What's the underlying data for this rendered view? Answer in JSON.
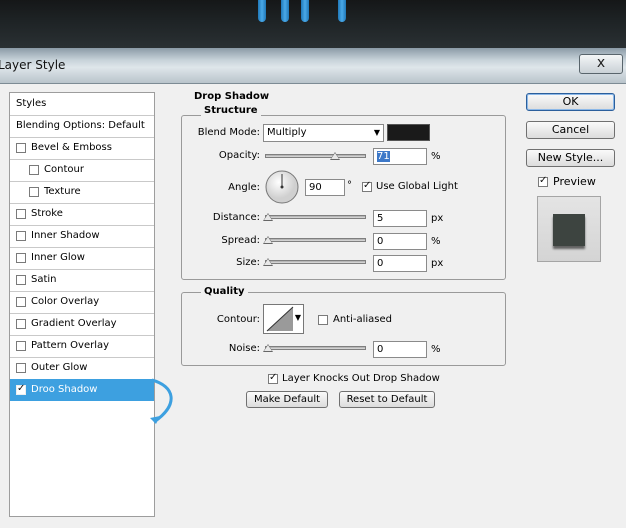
{
  "window": {
    "title": "Layer Style",
    "close_label": "x"
  },
  "sidebar": {
    "items": [
      {
        "label": "Styles",
        "checkbox": false,
        "checked": false,
        "selected": false,
        "indent": false
      },
      {
        "label": "Blending Options: Default",
        "checkbox": false,
        "checked": false,
        "selected": false,
        "indent": false
      },
      {
        "label": "Bevel & Emboss",
        "checkbox": true,
        "checked": false,
        "selected": false,
        "indent": false
      },
      {
        "label": "Contour",
        "checkbox": true,
        "checked": false,
        "selected": false,
        "indent": true
      },
      {
        "label": "Texture",
        "checkbox": true,
        "checked": false,
        "selected": false,
        "indent": true
      },
      {
        "label": "Stroke",
        "checkbox": true,
        "checked": false,
        "selected": false,
        "indent": false
      },
      {
        "label": "Inner Shadow",
        "checkbox": true,
        "checked": false,
        "selected": false,
        "indent": false
      },
      {
        "label": "Inner Glow",
        "checkbox": true,
        "checked": false,
        "selected": false,
        "indent": false
      },
      {
        "label": "Satin",
        "checkbox": true,
        "checked": false,
        "selected": false,
        "indent": false
      },
      {
        "label": "Color Overlay",
        "checkbox": true,
        "checked": false,
        "selected": false,
        "indent": false
      },
      {
        "label": "Gradient Overlay",
        "checkbox": true,
        "checked": false,
        "selected": false,
        "indent": false
      },
      {
        "label": "Pattern Overlay",
        "checkbox": true,
        "checked": false,
        "selected": false,
        "indent": false
      },
      {
        "label": "Outer Glow",
        "checkbox": true,
        "checked": false,
        "selected": false,
        "indent": false
      },
      {
        "label": "Droo Shadow",
        "checkbox": true,
        "checked": true,
        "selected": true,
        "indent": false
      }
    ]
  },
  "drop_shadow": {
    "title": "Drop Shadow",
    "structure": {
      "title": "Structure",
      "blend_mode_label": "Blend Mode:",
      "blend_mode_value": "Multiply",
      "shadow_color": "#1a1a1a",
      "opacity_label": "Opacity:",
      "opacity_value": "71",
      "opacity_unit": "%",
      "opacity_fraction": 0.71,
      "angle_label": "Angle:",
      "angle_value": "90",
      "angle_unit": "°",
      "use_global_light_label": "Use Global Light",
      "use_global_light_checked": true,
      "distance_label": "Distance:",
      "distance_value": "5",
      "distance_unit": "px",
      "spread_label": "Spread:",
      "spread_value": "0",
      "spread_unit": "%",
      "size_label": "Size:",
      "size_value": "0",
      "size_unit": "px"
    },
    "quality": {
      "title": "Quality",
      "contour_label": "Contour:",
      "anti_aliased_label": "Anti-aliased",
      "anti_aliased_checked": false,
      "noise_label": "Noise:",
      "noise_value": "0",
      "noise_unit": "%"
    },
    "knocks_out_label": "Layer Knocks Out Drop Shadow",
    "knocks_out_checked": true,
    "make_default_label": "Make Default",
    "reset_default_label": "Reset to Default"
  },
  "buttons": {
    "ok": "OK",
    "cancel": "Cancel",
    "new_style": "New Style...",
    "preview_label": "Preview",
    "preview_checked": true
  },
  "colors": {
    "selection": "#3da0e0",
    "arrow": "#3da0e0",
    "preview_swatch": "#3d4440"
  }
}
